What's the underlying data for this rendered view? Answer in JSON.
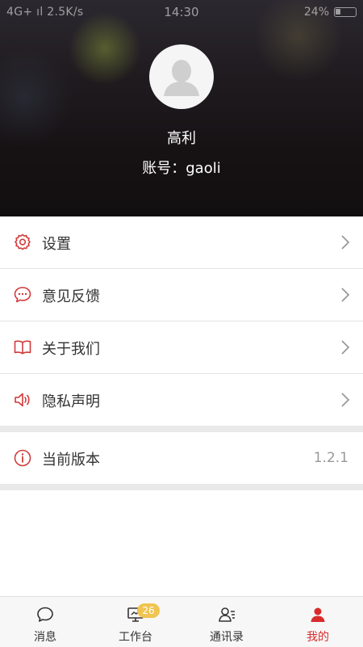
{
  "status_bar": {
    "left": "4G+ ıl  2.5K/s",
    "time": "14:30",
    "battery": "24%",
    "battery_level": 0.24
  },
  "profile": {
    "name": "高利",
    "account": "账号：gaoli"
  },
  "menu": [
    {
      "label": "设置",
      "icon": "gear-icon"
    },
    {
      "label": "意见反馈",
      "icon": "chat-bubble-icon"
    },
    {
      "label": "关于我们",
      "icon": "open-book-icon"
    },
    {
      "label": "隐私声明",
      "icon": "speaker-icon"
    }
  ],
  "version": {
    "label": "当前版本",
    "value": "1.2.1",
    "icon": "info-circle-icon"
  },
  "tabs": [
    {
      "label": "消息",
      "icon": "message-icon"
    },
    {
      "label": "工作台",
      "icon": "workbench-icon",
      "badge": "26"
    },
    {
      "label": "通讯录",
      "icon": "contacts-icon"
    },
    {
      "label": "我的",
      "icon": "person-icon",
      "active": true
    }
  ],
  "colors": {
    "accent": "#d92b2b",
    "badge": "#f0c451"
  }
}
